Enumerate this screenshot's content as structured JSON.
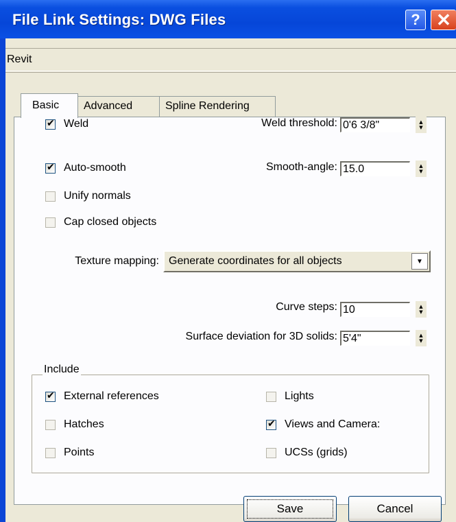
{
  "window": {
    "title": "File Link Settings: DWG Files",
    "help_label": "?",
    "close_label": "✕"
  },
  "preset": {
    "label": "Revit"
  },
  "tabs": [
    {
      "label": "Basic",
      "active": true
    },
    {
      "label": "Advanced",
      "active": false
    },
    {
      "label": "Spline Rendering",
      "active": false
    }
  ],
  "basic": {
    "weld": {
      "label": "Weld",
      "checked": true
    },
    "auto_smooth": {
      "label": "Auto-smooth",
      "checked": true
    },
    "unify_normals": {
      "label": "Unify normals",
      "checked": false
    },
    "cap_closed": {
      "label": "Cap closed objects",
      "checked": false
    },
    "weld_threshold": {
      "label": "Weld threshold:",
      "value": "0'6 3/8\""
    },
    "smooth_angle": {
      "label": "Smooth-angle:",
      "value": "15.0"
    },
    "texture_mapping": {
      "label": "Texture mapping:",
      "value": "Generate coordinates for all objects"
    },
    "curve_steps": {
      "label": "Curve steps:",
      "value": "10"
    },
    "surface_deviation": {
      "label": "Surface deviation for 3D solids:",
      "value": "5'4\""
    }
  },
  "include": {
    "title": "Include",
    "items": [
      {
        "label": "External references",
        "checked": true
      },
      {
        "label": "Hatches",
        "checked": false
      },
      {
        "label": "Points",
        "checked": false
      },
      {
        "label": "Lights",
        "checked": false
      },
      {
        "label": "Views and Camera:",
        "checked": true
      },
      {
        "label": "UCSs (grids)",
        "checked": false
      }
    ]
  },
  "buttons": {
    "save": "Save",
    "cancel": "Cancel"
  }
}
